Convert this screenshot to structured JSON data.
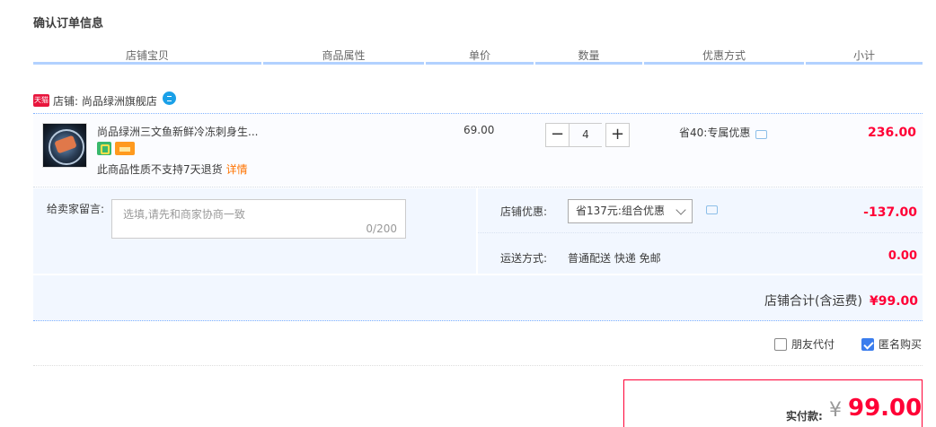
{
  "page": {
    "title": "确认订单信息"
  },
  "table_header": [
    "店铺宝贝",
    "商品属性",
    "单价",
    "数量",
    "优惠方式",
    "小计"
  ],
  "shop": {
    "badge": "天猫",
    "name": "店铺: 尚品绿洲旗舰店"
  },
  "item": {
    "title": "尚品绿洲三文鱼新鲜冷冻刺身生...",
    "note": "此商品性质不支持7天退货",
    "note_link": "详情",
    "price": "69.00",
    "quantity": "4",
    "minus": "−",
    "plus": "+",
    "promo": "省40:专属优惠",
    "subtotal": "236.00"
  },
  "message": {
    "label": "给卖家留言:",
    "placeholder": "选填,请先和商家协商一致",
    "count": "0/200"
  },
  "store_discount": {
    "label": "店铺优惠:",
    "selected": "省137元:组合优惠",
    "value": "-137.00"
  },
  "shipping": {
    "label": "运送方式:",
    "value": "普通配送 快递 免邮",
    "cost": "0.00"
  },
  "store_total": {
    "label": "店铺合计(含运费)",
    "amount": "¥99.00"
  },
  "options": {
    "friend_pay": {
      "label": "朋友代付",
      "checked": false
    },
    "anonymous": {
      "label": "匿名购买",
      "checked": true
    }
  },
  "payment": {
    "label": "实付款:",
    "currency": "¥",
    "amount": "99.00"
  },
  "colors": {
    "price_red": "#ff0036",
    "header_line": "#b2d1ff",
    "panel_bg": "#f2f7ff"
  }
}
